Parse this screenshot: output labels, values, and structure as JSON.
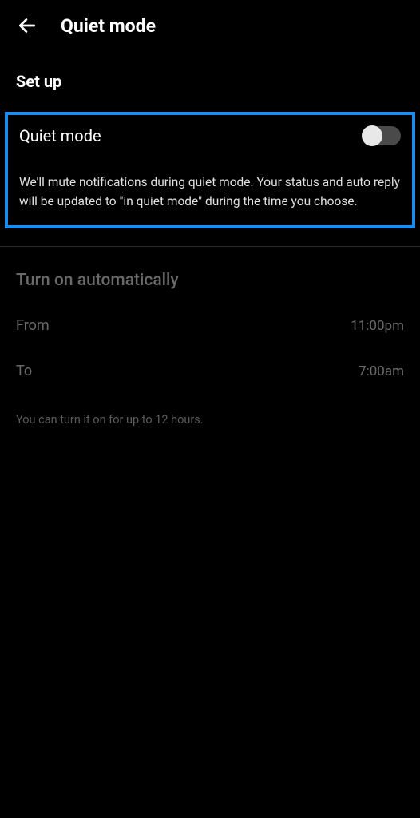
{
  "header": {
    "title": "Quiet mode"
  },
  "setup": {
    "section_title": "Set up",
    "toggle_label": "Quiet mode",
    "toggle_description": "We'll mute notifications during quiet mode. Your status and auto reply will be updated to \"in quiet mode\" during the time you choose."
  },
  "auto": {
    "section_title": "Turn on automatically",
    "from_label": "From",
    "from_value": "11:00pm",
    "to_label": "To",
    "to_value": "7:00am",
    "hint": "You can turn it on for up to 12 hours."
  }
}
